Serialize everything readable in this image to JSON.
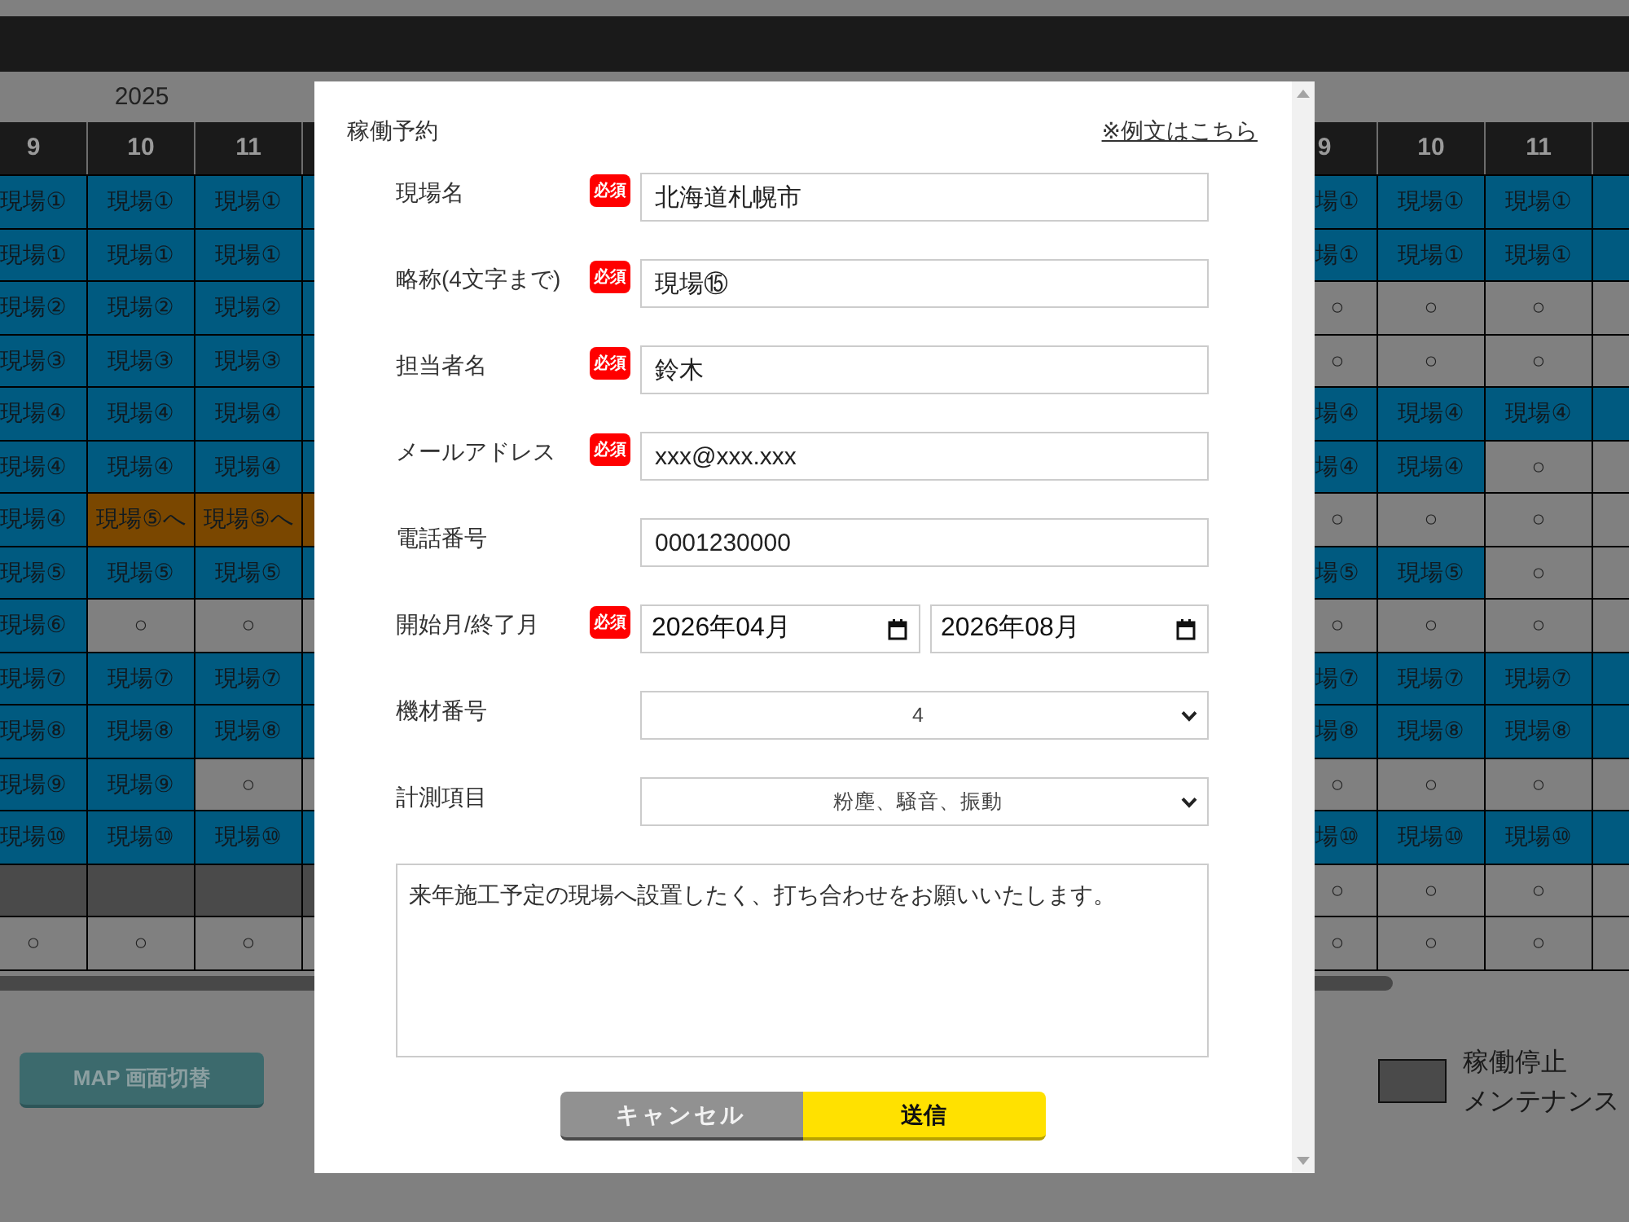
{
  "schedule_left": {
    "year": "2025",
    "headers": [
      "9",
      "10",
      "11"
    ],
    "rows": [
      [
        {
          "text": "現場①",
          "kind": "booked"
        },
        {
          "text": "現場①",
          "kind": "booked"
        },
        {
          "text": "現場①",
          "kind": "booked"
        },
        {
          "kind": "booked"
        }
      ],
      [
        {
          "text": "現場①",
          "kind": "booked"
        },
        {
          "text": "現場①",
          "kind": "booked"
        },
        {
          "text": "現場①",
          "kind": "booked"
        },
        {
          "kind": "booked"
        }
      ],
      [
        {
          "text": "現場②",
          "kind": "booked"
        },
        {
          "text": "現場②",
          "kind": "booked"
        },
        {
          "text": "現場②",
          "kind": "booked"
        },
        {
          "kind": "booked"
        }
      ],
      [
        {
          "text": "現場③",
          "kind": "booked"
        },
        {
          "text": "現場③",
          "kind": "booked"
        },
        {
          "text": "現場③",
          "kind": "booked"
        },
        {
          "kind": "booked"
        }
      ],
      [
        {
          "text": "現場④",
          "kind": "booked"
        },
        {
          "text": "現場④",
          "kind": "booked"
        },
        {
          "text": "現場④",
          "kind": "booked"
        },
        {
          "kind": "booked"
        }
      ],
      [
        {
          "text": "現場④",
          "kind": "booked"
        },
        {
          "text": "現場④",
          "kind": "booked"
        },
        {
          "text": "現場④",
          "kind": "booked"
        },
        {
          "kind": "booked"
        }
      ],
      [
        {
          "text": "現場④",
          "kind": "booked"
        },
        {
          "text": "現場⑤へ",
          "kind": "relocating"
        },
        {
          "text": "現場⑤へ",
          "kind": "relocating"
        },
        {
          "kind": "relocating"
        }
      ],
      [
        {
          "text": "現場⑤",
          "kind": "booked"
        },
        {
          "text": "現場⑤",
          "kind": "booked"
        },
        {
          "text": "現場⑤",
          "kind": "booked"
        },
        {
          "kind": "booked"
        }
      ],
      [
        {
          "text": "現場⑥",
          "kind": "booked"
        },
        {
          "text": "○",
          "kind": "available"
        },
        {
          "text": "○",
          "kind": "available"
        },
        {
          "kind": "available"
        }
      ],
      [
        {
          "text": "現場⑦",
          "kind": "booked"
        },
        {
          "text": "現場⑦",
          "kind": "booked"
        },
        {
          "text": "現場⑦",
          "kind": "booked"
        },
        {
          "kind": "booked"
        }
      ],
      [
        {
          "text": "現場⑧",
          "kind": "booked"
        },
        {
          "text": "現場⑧",
          "kind": "booked"
        },
        {
          "text": "現場⑧",
          "kind": "booked"
        },
        {
          "kind": "booked"
        }
      ],
      [
        {
          "text": "現場⑨",
          "kind": "booked"
        },
        {
          "text": "現場⑨",
          "kind": "booked"
        },
        {
          "text": "○",
          "kind": "available"
        },
        {
          "kind": "available"
        }
      ],
      [
        {
          "text": "現場⑩",
          "kind": "booked"
        },
        {
          "text": "現場⑩",
          "kind": "booked"
        },
        {
          "text": "現場⑩",
          "kind": "booked"
        },
        {
          "kind": "booked"
        }
      ],
      [
        {
          "kind": "stopped"
        },
        {
          "kind": "stopped"
        },
        {
          "kind": "stopped"
        },
        {
          "kind": "stopped"
        }
      ],
      [
        {
          "text": "○",
          "kind": "available"
        },
        {
          "text": "○",
          "kind": "available"
        },
        {
          "text": "○",
          "kind": "available"
        },
        {
          "kind": "available"
        }
      ]
    ]
  },
  "schedule_right": {
    "headers": [
      "9",
      "10",
      "11"
    ],
    "rows": [
      [
        {
          "text": "場①",
          "kind": "booked"
        },
        {
          "text": "現場①",
          "kind": "booked"
        },
        {
          "text": "現場①",
          "kind": "booked"
        },
        {
          "kind": "booked"
        }
      ],
      [
        {
          "text": "場①",
          "kind": "booked"
        },
        {
          "text": "現場①",
          "kind": "booked"
        },
        {
          "text": "現場①",
          "kind": "booked"
        },
        {
          "kind": "booked"
        }
      ],
      [
        {
          "text": "○",
          "kind": "available"
        },
        {
          "text": "○",
          "kind": "available"
        },
        {
          "text": "○",
          "kind": "available"
        },
        {
          "kind": "available"
        }
      ],
      [
        {
          "text": "○",
          "kind": "available"
        },
        {
          "text": "○",
          "kind": "available"
        },
        {
          "text": "○",
          "kind": "available"
        },
        {
          "kind": "available"
        }
      ],
      [
        {
          "text": "場④",
          "kind": "booked"
        },
        {
          "text": "現場④",
          "kind": "booked"
        },
        {
          "text": "現場④",
          "kind": "booked"
        },
        {
          "kind": "booked"
        }
      ],
      [
        {
          "text": "場④",
          "kind": "booked"
        },
        {
          "text": "現場④",
          "kind": "booked"
        },
        {
          "text": "○",
          "kind": "available"
        },
        {
          "kind": "available"
        }
      ],
      [
        {
          "text": "○",
          "kind": "available"
        },
        {
          "text": "○",
          "kind": "available"
        },
        {
          "text": "○",
          "kind": "available"
        },
        {
          "kind": "available"
        }
      ],
      [
        {
          "text": "場⑤",
          "kind": "booked"
        },
        {
          "text": "現場⑤",
          "kind": "booked"
        },
        {
          "text": "○",
          "kind": "available"
        },
        {
          "kind": "available"
        }
      ],
      [
        {
          "text": "○",
          "kind": "available"
        },
        {
          "text": "○",
          "kind": "available"
        },
        {
          "text": "○",
          "kind": "available"
        },
        {
          "kind": "available"
        }
      ],
      [
        {
          "text": "場⑦",
          "kind": "booked"
        },
        {
          "text": "現場⑦",
          "kind": "booked"
        },
        {
          "text": "現場⑦",
          "kind": "booked"
        },
        {
          "kind": "booked"
        }
      ],
      [
        {
          "text": "場⑧",
          "kind": "booked"
        },
        {
          "text": "現場⑧",
          "kind": "booked"
        },
        {
          "text": "現場⑧",
          "kind": "booked"
        },
        {
          "kind": "booked"
        }
      ],
      [
        {
          "text": "○",
          "kind": "available"
        },
        {
          "text": "○",
          "kind": "available"
        },
        {
          "text": "○",
          "kind": "available"
        },
        {
          "kind": "available"
        }
      ],
      [
        {
          "text": "場⑩",
          "kind": "booked"
        },
        {
          "text": "現場⑩",
          "kind": "booked"
        },
        {
          "text": "現場⑩",
          "kind": "booked"
        },
        {
          "kind": "booked"
        }
      ],
      [
        {
          "text": "○",
          "kind": "available"
        },
        {
          "text": "○",
          "kind": "available"
        },
        {
          "text": "○",
          "kind": "available"
        },
        {
          "kind": "available"
        }
      ],
      [
        {
          "text": "○",
          "kind": "available"
        },
        {
          "text": "○",
          "kind": "available"
        },
        {
          "text": "○",
          "kind": "available"
        },
        {
          "kind": "available"
        }
      ]
    ]
  },
  "map_button": "MAP 画面切替",
  "legend": [
    {
      "kind": "stopped",
      "label": "稼働停止",
      "sublabel": "メンテナンス"
    }
  ],
  "dialog": {
    "title": "稼働予約",
    "example_link": "※例文はこちら",
    "fields": [
      {
        "label": "現場名",
        "badge": "必須",
        "kind": "text",
        "value": "北海道札幌市"
      },
      {
        "label": "略称(4文字まで)",
        "badge": "必須",
        "kind": "text",
        "value": "現場⑮"
      },
      {
        "label": "担当者名",
        "badge": "必須",
        "kind": "text",
        "value": "鈴木"
      },
      {
        "label": "メールアドレス",
        "badge": "必須",
        "kind": "text",
        "value": "xxx@xxx.xxx"
      },
      {
        "label": "電話番号",
        "kind": "text",
        "value": "0001230000"
      },
      {
        "label": "開始月/終了月",
        "badge": "必須",
        "kind": "month_range",
        "values": [
          "2026年04月",
          "2026年08月"
        ]
      },
      {
        "label": "機材番号",
        "kind": "select",
        "value": "4"
      },
      {
        "label": "計測項目",
        "kind": "select",
        "value": "粉塵、騒音、振動"
      }
    ],
    "message": "来年施工予定の現場へ設置したく、打ち合わせをお願いいたします。",
    "buttons": [
      {
        "label": "キャンセル",
        "kind": "cancel"
      },
      {
        "label": "送信",
        "kind": "submit"
      }
    ]
  }
}
